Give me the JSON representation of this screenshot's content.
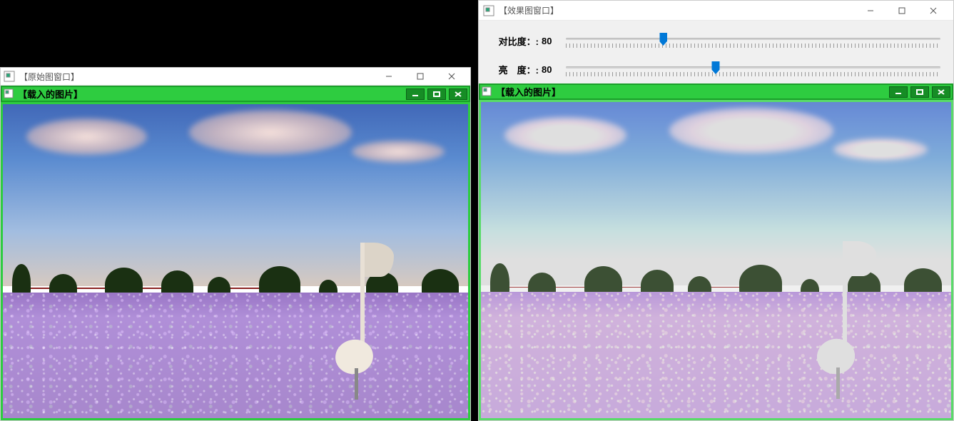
{
  "leftWindow": {
    "title": "【原始图窗口】"
  },
  "rightWindow": {
    "title": "【效果图窗口】",
    "contrast": {
      "label": "对比度：:",
      "value": "80",
      "percent": 26
    },
    "brightness": {
      "label": "亮　度：:",
      "value": "80",
      "percent": 40
    }
  },
  "imagePanel": {
    "title": "【载入的图片】"
  }
}
